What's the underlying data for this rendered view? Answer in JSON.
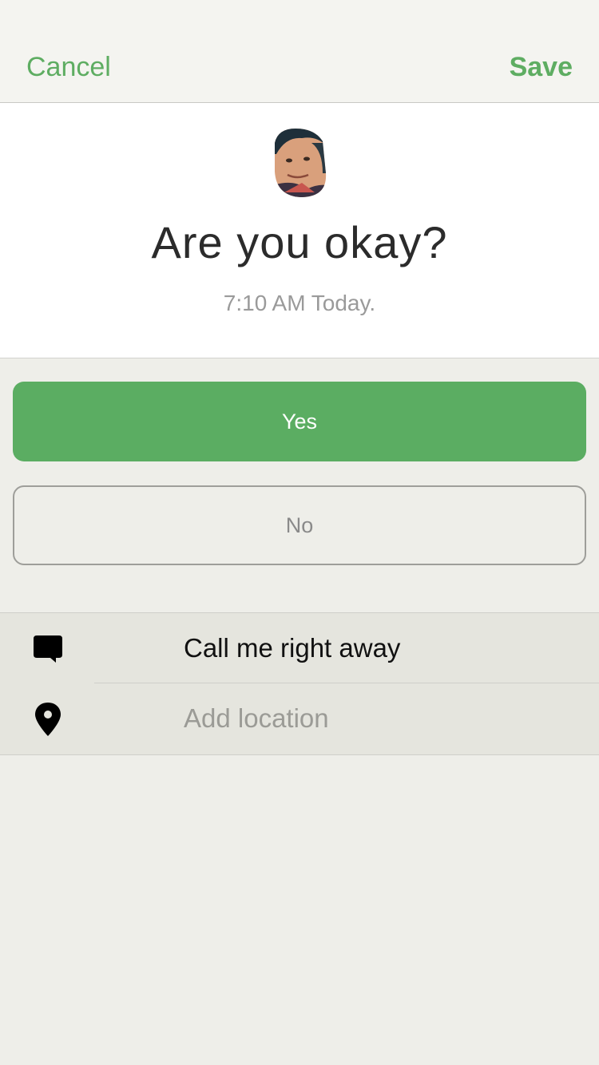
{
  "nav": {
    "cancel_label": "Cancel",
    "save_label": "Save"
  },
  "header": {
    "title": "Are you okay?",
    "timestamp": "7:10 AM Today."
  },
  "actions": {
    "yes_label": "Yes",
    "no_label": "No"
  },
  "options": {
    "call": {
      "icon": "speech-bubble-icon",
      "label": "Call me right away"
    },
    "location": {
      "icon": "map-pin-icon",
      "placeholder": "Add location"
    }
  },
  "colors": {
    "accent": "#5bad62",
    "background": "#eeeee9",
    "options_background": "#e5e5de"
  }
}
